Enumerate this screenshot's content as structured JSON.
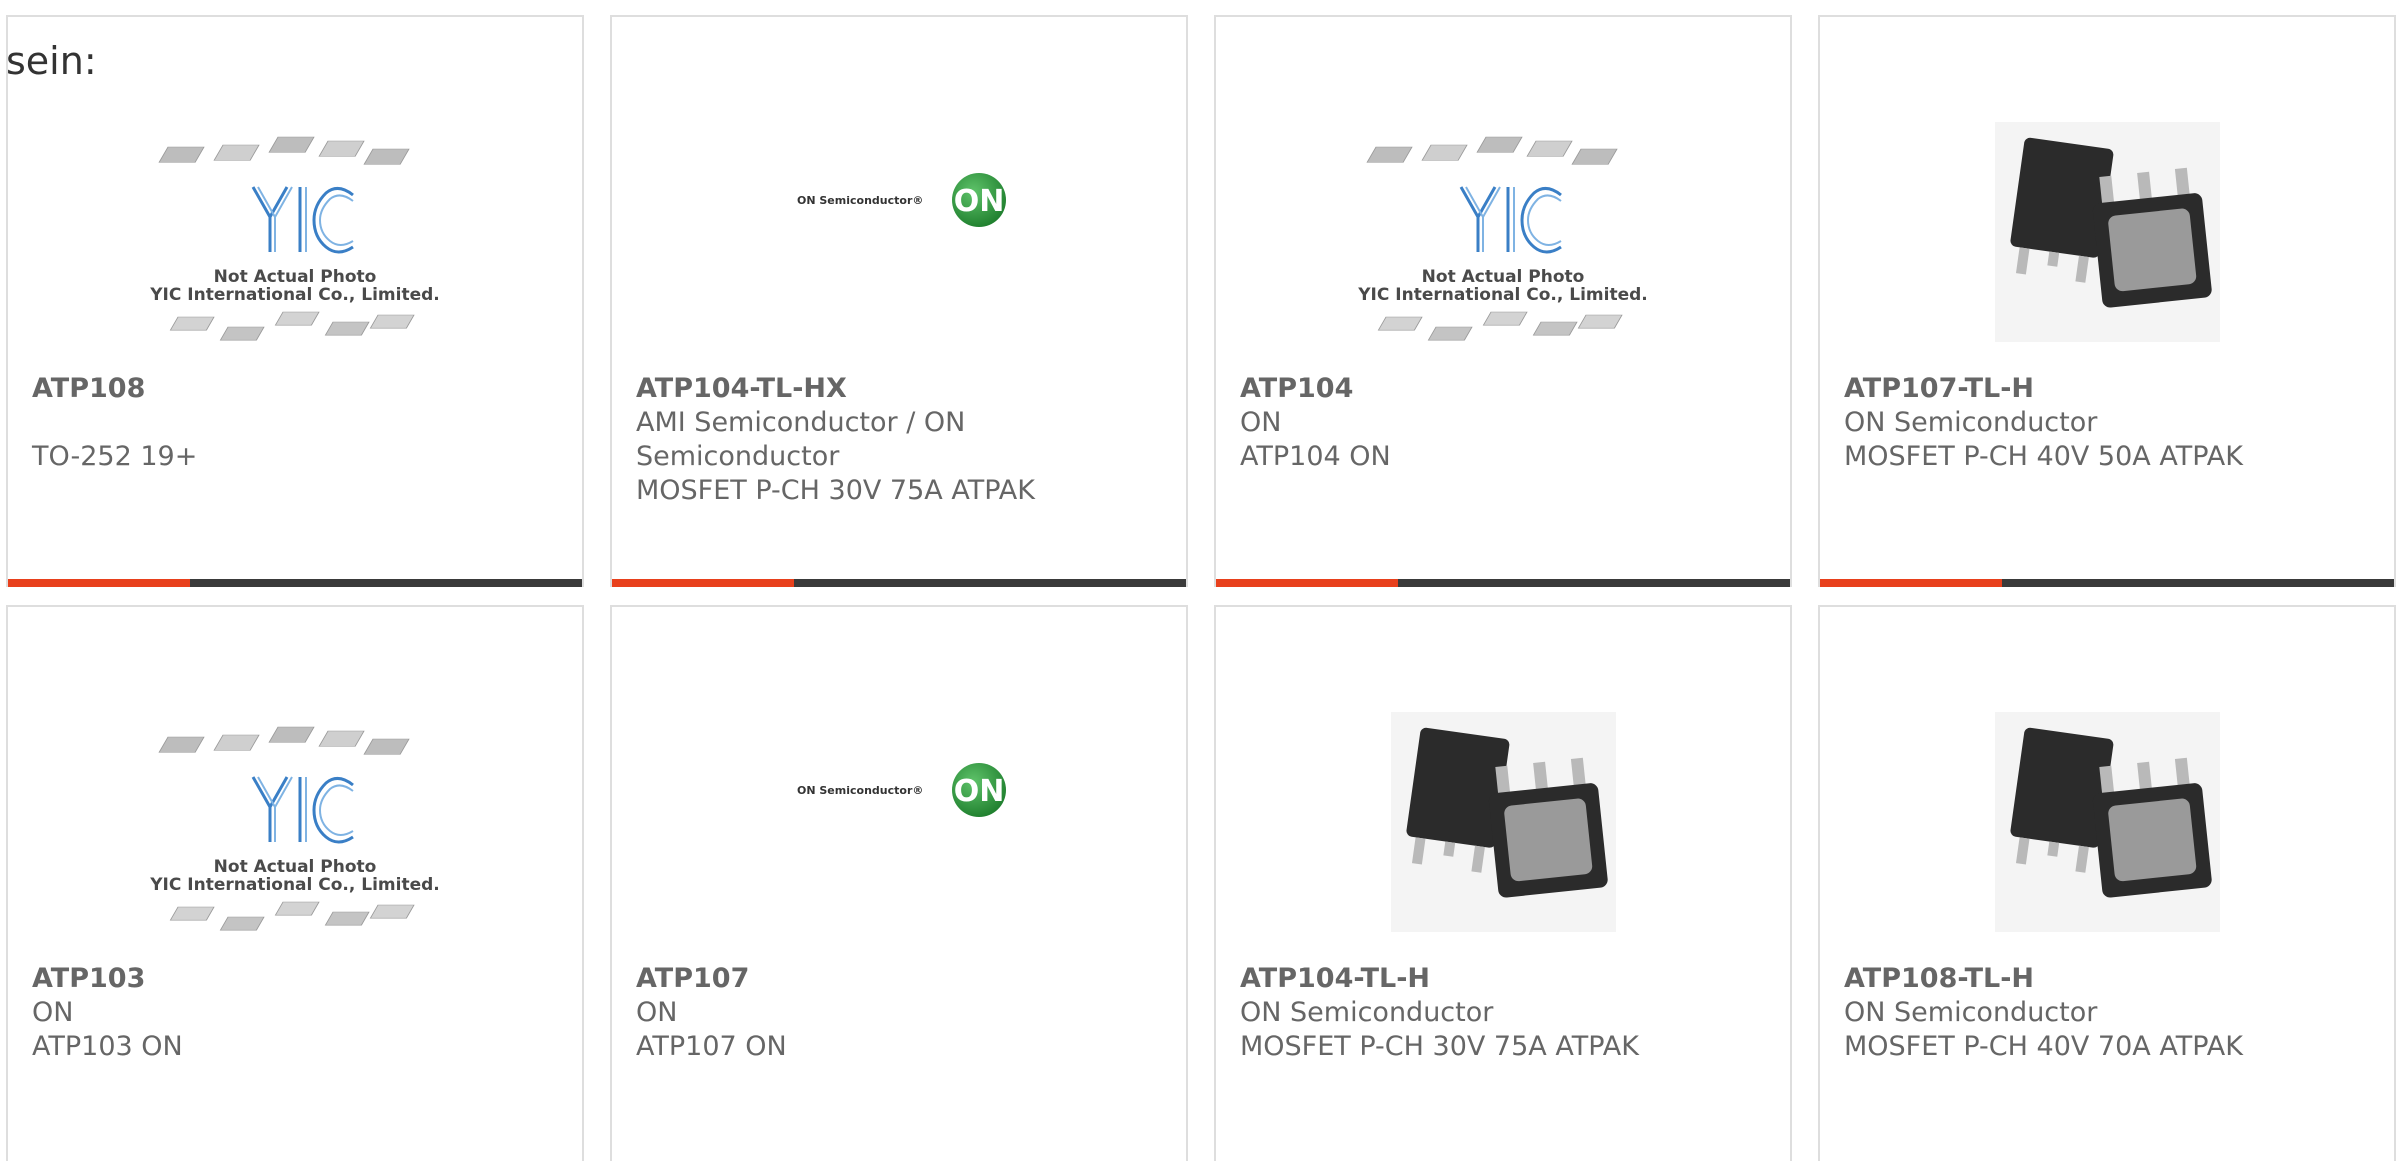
{
  "intro_text": "sein:",
  "accent_color": "#e8401c",
  "bar_color": "#3a3a3a",
  "placeholder_caption": {
    "line1": "Not Actual Photo",
    "line2": "YIC International Co., Limited.",
    "logo": "YIC"
  },
  "on_logo": {
    "wordmark": "ON Semiconductor",
    "badge": "ON"
  },
  "products": [
    {
      "title": "ATP108",
      "manufacturer": "",
      "description": "TO-252 19+",
      "image": "yic-placeholder"
    },
    {
      "title": "ATP104-TL-HX",
      "manufacturer": "AMI Semiconductor / ON Semiconductor",
      "description": "MOSFET P-CH 30V 75A ATPAK",
      "image": "on-semi-logo"
    },
    {
      "title": "ATP104",
      "manufacturer": "ON",
      "description": "ATP104 ON",
      "image": "yic-placeholder"
    },
    {
      "title": "ATP107-TL-H",
      "manufacturer": "ON Semiconductor",
      "description": "MOSFET P-CH 40V 50A ATPAK",
      "image": "atpak-package"
    },
    {
      "title": "ATP103",
      "manufacturer": "ON",
      "description": "ATP103 ON",
      "image": "yic-placeholder"
    },
    {
      "title": "ATP107",
      "manufacturer": "ON",
      "description": "ATP107 ON",
      "image": "on-semi-logo"
    },
    {
      "title": "ATP104-TL-H",
      "manufacturer": "ON Semiconductor",
      "description": "MOSFET P-CH 30V 75A ATPAK",
      "image": "atpak-package"
    },
    {
      "title": "ATP108-TL-H",
      "manufacturer": "ON Semiconductor",
      "description": "MOSFET P-CH 40V 70A ATPAK",
      "image": "atpak-package"
    }
  ]
}
